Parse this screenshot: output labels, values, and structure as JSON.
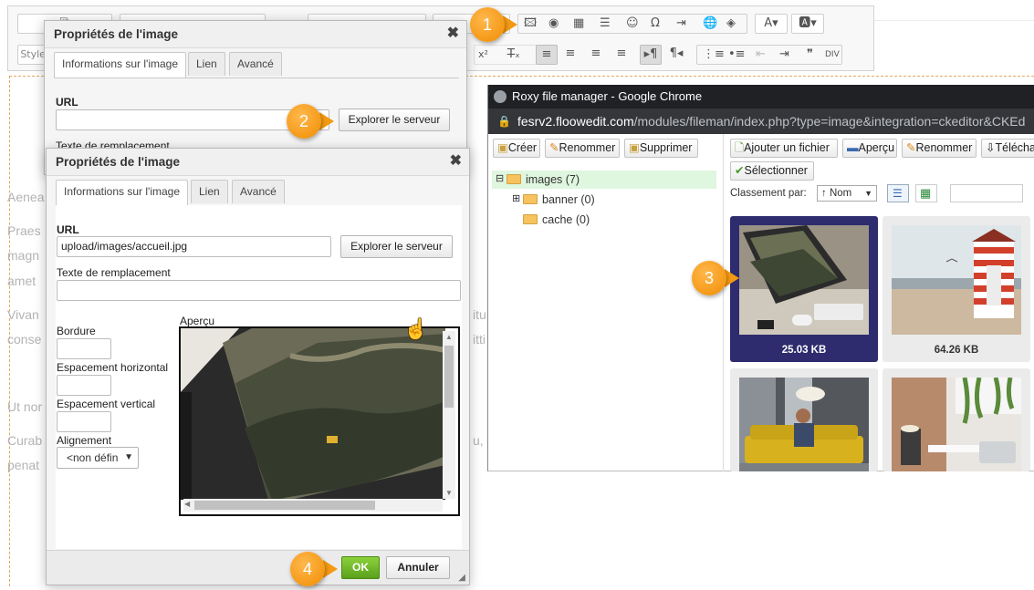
{
  "editor": {
    "format_combo": "Styles",
    "dashed_color": "#e5a75e",
    "bg_lines": [
      "Aenea",
      "Praes",
      "magn",
      "amet",
      "Vivan",
      "conse",
      "Ut nor",
      "Curab",
      "penat"
    ],
    "bg_right_fragments": [
      "itu",
      "itti",
      "u,"
    ]
  },
  "dialog_back": {
    "title": "Propriétés de l'image",
    "tabs": [
      "Informations sur l'image",
      "Lien",
      "Avancé"
    ],
    "url_label": "URL",
    "url_value": "",
    "browse_button": "Explorer le serveur",
    "alt_label": "Texte de remplacement"
  },
  "dialog_front": {
    "title": "Propriétés de l'image",
    "tabs": [
      "Informations sur l'image",
      "Lien",
      "Avancé"
    ],
    "url_label": "URL",
    "url_value": "upload/images/accueil.jpg",
    "browse_button": "Explorer le serveur",
    "alt_label": "Texte de remplacement",
    "alt_value": "",
    "border_label": "Bordure",
    "hspace_label": "Espacement horizontal",
    "vspace_label": "Espacement vertical",
    "align_label": "Alignement",
    "align_value": "<non défin",
    "preview_label": "Aperçu",
    "ok_button": "OK",
    "cancel_button": "Annuler",
    "ok_color": "#5aa01c"
  },
  "file_manager": {
    "window_title": "Roxy file manager - Google Chrome",
    "url_host": "fesrv2.floowedit.com",
    "url_path": "/modules/fileman/index.php?type=image&integration=ckeditor&CKEd",
    "dir_toolbar": [
      "Créer",
      "Renommer",
      "Supprimer"
    ],
    "file_toolbar": [
      "Ajouter un fichier",
      "Aperçu",
      "Renommer",
      "Télécha",
      "Sélectionner"
    ],
    "sort_label": "Classement par:",
    "sort_value": "↑  Nom",
    "folders": [
      {
        "name": "images (7)",
        "expanded": true,
        "selected": true
      },
      {
        "name": "banner (0)",
        "expandable": true
      },
      {
        "name": "cache (0)"
      }
    ],
    "thumbnails": [
      {
        "size": "25.03 KB",
        "selected": true,
        "subject": "laptop on desk"
      },
      {
        "size": "64.26 KB",
        "selected": false,
        "subject": "beach hut"
      },
      {
        "size": "",
        "selected": false,
        "subject": "man on yellow sofa"
      },
      {
        "size": "",
        "selected": false,
        "subject": "lounge with plants"
      }
    ],
    "selected_color": "#2e2c6e"
  },
  "callouts": [
    "1",
    "2",
    "3",
    "4"
  ],
  "accent_color": "#f39a12"
}
